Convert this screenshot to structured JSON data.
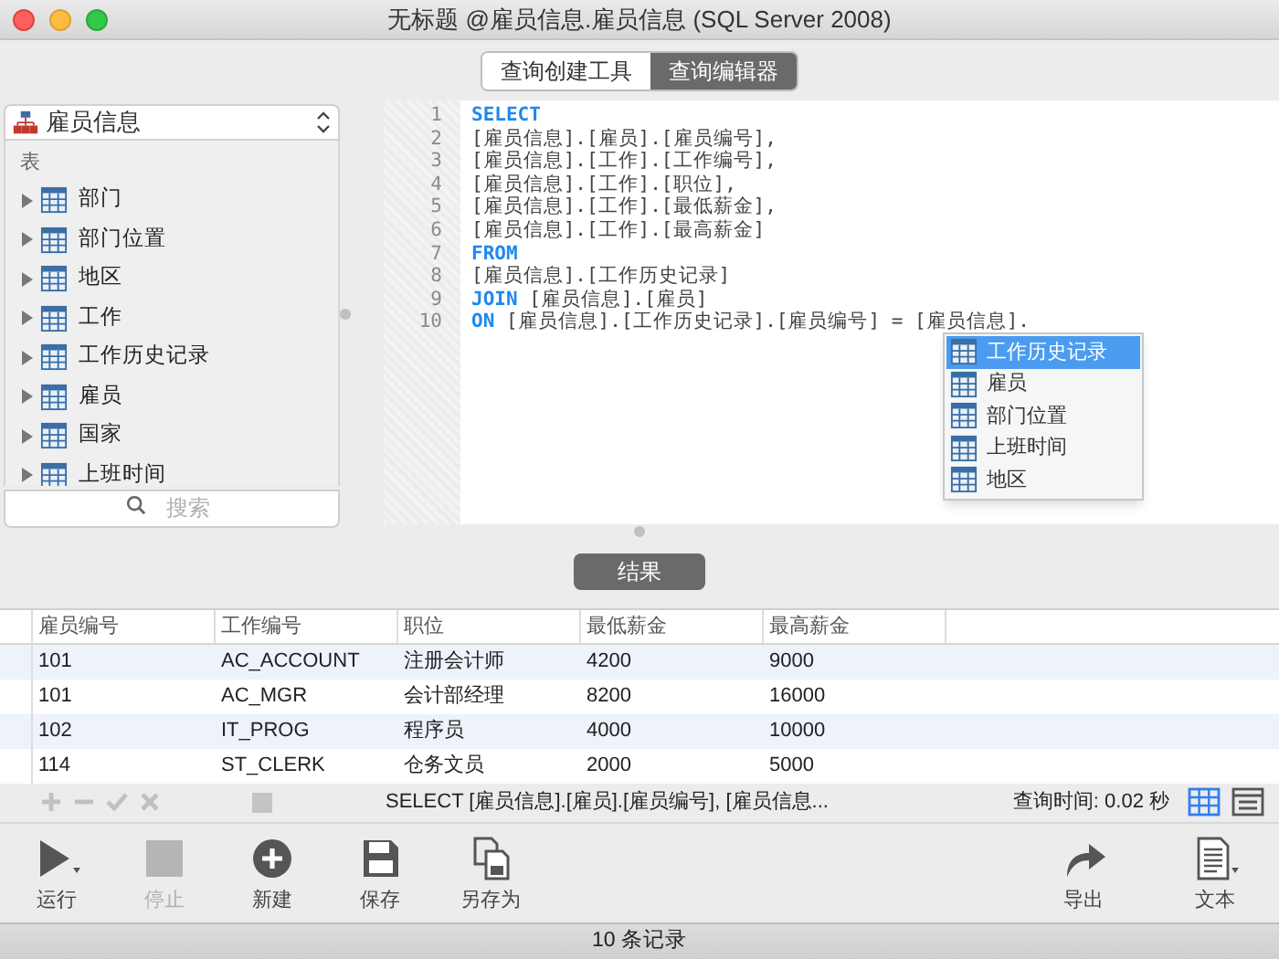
{
  "window": {
    "title": "无标题 @雇员信息.雇员信息 (SQL Server 2008)"
  },
  "mode_tabs": [
    {
      "label": "查询创建工具",
      "selected": false
    },
    {
      "label": "查询编辑器",
      "selected": true
    }
  ],
  "sidebar": {
    "database": "雇员信息",
    "section": "表",
    "items": [
      {
        "label": "部门",
        "expanded": false
      },
      {
        "label": "部门位置",
        "expanded": false
      },
      {
        "label": "地区",
        "expanded": false
      },
      {
        "label": "工作",
        "expanded": false
      },
      {
        "label": "工作历史记录",
        "expanded": false
      },
      {
        "label": "雇员",
        "expanded": false
      },
      {
        "label": "国家",
        "expanded": false
      },
      {
        "label": "上班时间",
        "expanded": false
      }
    ],
    "search": {
      "placeholder": "搜索"
    }
  },
  "editor": {
    "lines": [
      {
        "number": "1",
        "keyword": "SELECT"
      },
      {
        "number": "2",
        "text": "[雇员信息].[雇员].[雇员编号],"
      },
      {
        "number": "3",
        "text": "[雇员信息].[工作].[工作编号],"
      },
      {
        "number": "4",
        "text": "[雇员信息].[工作].[职位],"
      },
      {
        "number": "5",
        "text": "[雇员信息].[工作].[最低薪金],"
      },
      {
        "number": "6",
        "text": "[雇员信息].[工作].[最高薪金]"
      },
      {
        "number": "7",
        "keyword": "FROM"
      },
      {
        "number": "8",
        "text": "[雇员信息].[工作历史记录]"
      },
      {
        "number": "9",
        "keyword": "JOIN",
        "text": "[雇员信息].[雇员]"
      },
      {
        "number": "10",
        "keyword": "ON",
        "text": "[雇员信息].[工作历史记录].[雇员编号] = [雇员信息]."
      }
    ],
    "autocomplete": [
      {
        "label": "工作历史记录",
        "selected": true
      },
      {
        "label": "雇员",
        "selected": false
      },
      {
        "label": "部门位置",
        "selected": false
      },
      {
        "label": "上班时间",
        "selected": false
      },
      {
        "label": "地区",
        "selected": false
      }
    ]
  },
  "results_button": "结果",
  "table": {
    "columns": [
      "雇员编号",
      "工作编号",
      "职位",
      "最低薪金",
      "最高薪金"
    ],
    "rows": [
      [
        "101",
        "AC_ACCOUNT",
        "注册会计师",
        "4200",
        "9000"
      ],
      [
        "101",
        "AC_MGR",
        "会计部经理",
        "8200",
        "16000"
      ],
      [
        "102",
        "IT_PROG",
        "程序员",
        "4000",
        "10000"
      ],
      [
        "114",
        "ST_CLERK",
        "仓务文员",
        "2000",
        "5000"
      ]
    ]
  },
  "table_toolbar": {
    "query": "SELECT [雇员信息].[雇员].[雇员编号], [雇员信息...",
    "query_time": "查询时间: 0.02 秒",
    "views": [
      {
        "kind": "grid",
        "selected": true
      },
      {
        "kind": "form",
        "selected": false
      }
    ]
  },
  "toolbar": {
    "left": [
      {
        "kind": "run",
        "label": "运行",
        "disabled": false
      },
      {
        "kind": "stop",
        "label": "停止",
        "disabled": true
      },
      {
        "kind": "new",
        "label": "新建",
        "disabled": false
      },
      {
        "kind": "save",
        "label": "保存",
        "disabled": false
      },
      {
        "kind": "saveas",
        "label": "另存为",
        "disabled": false
      }
    ],
    "right": [
      {
        "kind": "export",
        "label": "导出",
        "disabled": false
      },
      {
        "kind": "text",
        "label": "文本",
        "disabled": false
      }
    ]
  },
  "status_bar": "10 条记录"
}
